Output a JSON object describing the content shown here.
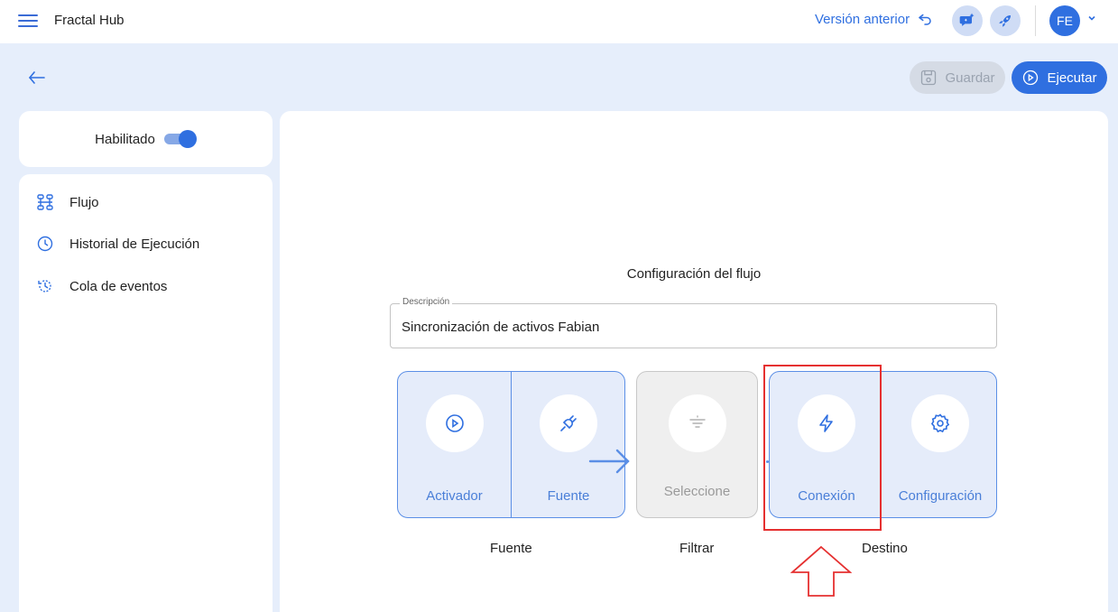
{
  "topbar": {
    "title": "Fractal Hub",
    "prev_version": "Versión anterior",
    "avatar_initials": "FE"
  },
  "actions": {
    "save": "Guardar",
    "execute": "Ejecutar"
  },
  "sidebar": {
    "enabled_label": "Habilitado",
    "enabled": true,
    "items": [
      {
        "label": "Flujo",
        "icon": "flow-icon"
      },
      {
        "label": "Historial de Ejecución",
        "icon": "clock-icon"
      },
      {
        "label": "Cola de eventos",
        "icon": "history-icon"
      }
    ]
  },
  "main": {
    "config_title": "Configuración del flujo",
    "description": {
      "label": "Descripción",
      "value": "Sincronización de activos Fabian"
    },
    "steps": {
      "activator": "Activador",
      "source": "Fuente",
      "filter": "Seleccione",
      "connection": "Conexión",
      "configuration": "Configuración"
    },
    "groups": {
      "source": "Fuente",
      "filter": "Filtrar",
      "destination": "Destino"
    }
  },
  "colors": {
    "accent": "#2f6fe0",
    "background": "#e6eefb",
    "step_fill": "#e5ecfa",
    "highlight": "#e53030"
  }
}
